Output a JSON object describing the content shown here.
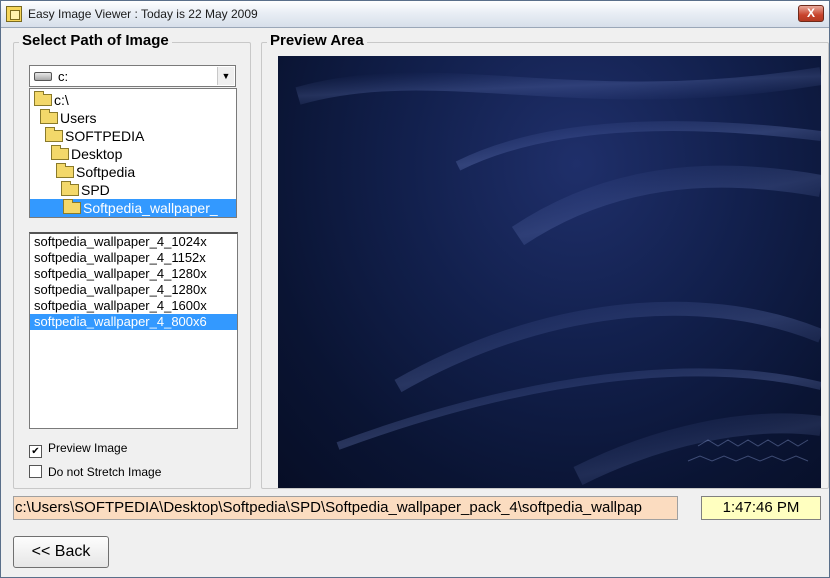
{
  "window": {
    "title": "Easy Image Viewer : Today is 22 May 2009",
    "close_label": "X"
  },
  "left_panel": {
    "title": "Select Path of Image",
    "drive_select": {
      "value": "c:"
    },
    "tree": [
      {
        "label": "c:\\",
        "selected": false
      },
      {
        "label": "Users",
        "selected": false
      },
      {
        "label": "SOFTPEDIA",
        "selected": false
      },
      {
        "label": "Desktop",
        "selected": false
      },
      {
        "label": "Softpedia",
        "selected": false
      },
      {
        "label": "SPD",
        "selected": false
      },
      {
        "label": "Softpedia_wallpaper_",
        "selected": true
      }
    ],
    "files": [
      "softpedia_wallpaper_4_1024x",
      "softpedia_wallpaper_4_1152x",
      "softpedia_wallpaper_4_1280x",
      "softpedia_wallpaper_4_1280x",
      "softpedia_wallpaper_4_1600x",
      "softpedia_wallpaper_4_800x6"
    ],
    "selected_file_index": 5,
    "preview_checkbox": {
      "label": "Preview Image",
      "checked": true
    },
    "stretch_checkbox": {
      "label": "Do not Stretch Image",
      "checked": false
    }
  },
  "right_panel": {
    "title": "Preview Area"
  },
  "status": {
    "path": "c:\\Users\\SOFTPEDIA\\Desktop\\Softpedia\\SPD\\Softpedia_wallpaper_pack_4\\softpedia_wallpap",
    "time": "1:47:46 PM"
  },
  "back_button": {
    "label": "<< Back"
  },
  "colors": {
    "selection": "#3399ff",
    "path_bg": "#fbdcc0",
    "time_bg": "#ffffc0",
    "preview_bg": "#0a1433"
  }
}
